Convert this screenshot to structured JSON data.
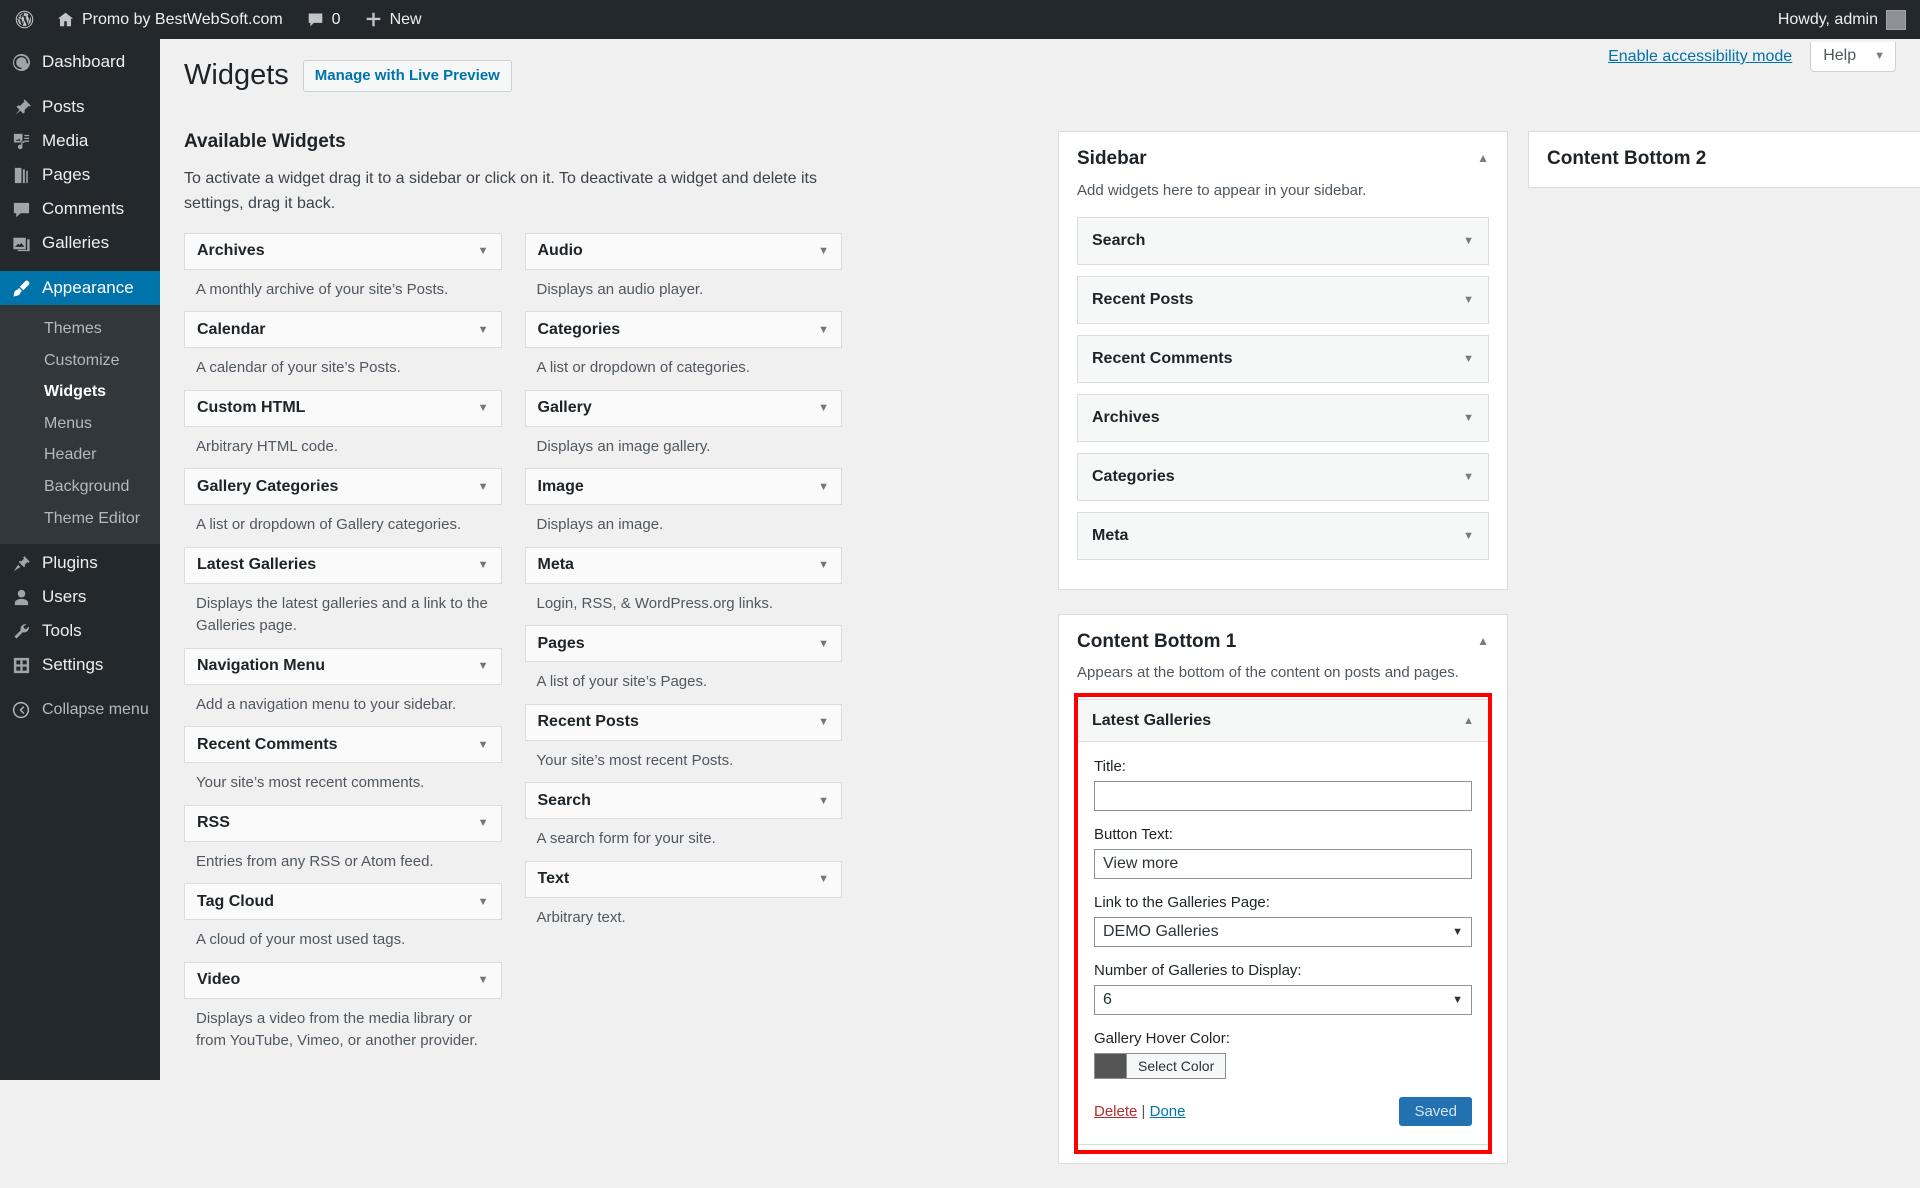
{
  "adminbar": {
    "wp_logo": "wordpress-logo-icon",
    "site_name": "Promo by BestWebSoft.com",
    "comments_count": "0",
    "new_label": "New",
    "howdy": "Howdy, admin"
  },
  "sidebar": {
    "items": [
      {
        "label": "Dashboard",
        "icon": "dashboard-icon",
        "current": false
      },
      {
        "label": "Posts",
        "icon": "pin-icon",
        "current": false
      },
      {
        "label": "Media",
        "icon": "media-icon",
        "current": false
      },
      {
        "label": "Pages",
        "icon": "pages-icon",
        "current": false
      },
      {
        "label": "Comments",
        "icon": "comments-icon",
        "current": false
      },
      {
        "label": "Galleries",
        "icon": "galleries-icon",
        "current": false
      },
      {
        "label": "Appearance",
        "icon": "appearance-brush-icon",
        "current": true
      },
      {
        "label": "Plugins",
        "icon": "plugins-plug-icon",
        "current": false
      },
      {
        "label": "Users",
        "icon": "users-icon",
        "current": false
      },
      {
        "label": "Tools",
        "icon": "tools-wrench-icon",
        "current": false
      },
      {
        "label": "Settings",
        "icon": "settings-gear-icon",
        "current": false
      }
    ],
    "appearance_submenu": [
      {
        "label": "Themes",
        "current": false
      },
      {
        "label": "Customize",
        "current": false
      },
      {
        "label": "Widgets",
        "current": true
      },
      {
        "label": "Menus",
        "current": false
      },
      {
        "label": "Header",
        "current": false
      },
      {
        "label": "Background",
        "current": false
      },
      {
        "label": "Theme Editor",
        "current": false
      }
    ],
    "collapse_label": "Collapse menu",
    "collapse_icon": "collapse-arrow-icon"
  },
  "screen_meta": {
    "accessibility_link": "Enable accessibility mode",
    "help_label": "Help",
    "help_caret": "chevron-down-icon"
  },
  "page": {
    "title": "Widgets",
    "live_preview_button": "Manage with Live Preview",
    "available_heading": "Available Widgets",
    "available_description": "To activate a widget drag it to a sidebar or click on it. To deactivate a widget and delete its settings, drag it back."
  },
  "available_widgets": {
    "left_column": [
      {
        "name": "Archives",
        "description": "A monthly archive of your site’s Posts."
      },
      {
        "name": "Calendar",
        "description": "A calendar of your site’s Posts."
      },
      {
        "name": "Custom HTML",
        "description": "Arbitrary HTML code."
      },
      {
        "name": "Gallery Categories",
        "description": "A list or dropdown of Gallery categories."
      },
      {
        "name": "Latest Galleries",
        "description": "Displays the latest galleries and a link to the Galleries page."
      },
      {
        "name": "Navigation Menu",
        "description": "Add a navigation menu to your sidebar."
      },
      {
        "name": "Recent Comments",
        "description": "Your site’s most recent comments."
      },
      {
        "name": "RSS",
        "description": "Entries from any RSS or Atom feed."
      },
      {
        "name": "Tag Cloud",
        "description": "A cloud of your most used tags."
      },
      {
        "name": "Video",
        "description": "Displays a video from the media library or from YouTube, Vimeo, or another provider."
      }
    ],
    "right_column": [
      {
        "name": "Audio",
        "description": "Displays an audio player."
      },
      {
        "name": "Categories",
        "description": "A list or dropdown of categories."
      },
      {
        "name": "Gallery",
        "description": "Displays an image gallery."
      },
      {
        "name": "Image",
        "description": "Displays an image."
      },
      {
        "name": "Meta",
        "description": "Login, RSS, & WordPress.org links."
      },
      {
        "name": "Pages",
        "description": "A list of your site’s Pages."
      },
      {
        "name": "Recent Posts",
        "description": "Your site’s most recent Posts."
      },
      {
        "name": "Search",
        "description": "A search form for your site."
      },
      {
        "name": "Text",
        "description": "Arbitrary text."
      }
    ]
  },
  "sidebar_areas": {
    "sidebar": {
      "title": "Sidebar",
      "description": "Add widgets here to appear in your sidebar.",
      "widgets": [
        "Search",
        "Recent Posts",
        "Recent Comments",
        "Archives",
        "Categories",
        "Meta"
      ]
    },
    "content_bottom_1": {
      "title": "Content Bottom 1",
      "description": "Appears at the bottom of the content on posts and pages."
    },
    "content_bottom_2": {
      "title": "Content Bottom 2"
    }
  },
  "latest_galleries_form": {
    "widget_title": "Latest Galleries",
    "title_label": "Title:",
    "title_value": "",
    "button_text_label": "Button Text:",
    "button_text_value": "View more",
    "link_label": "Link to the Galleries Page:",
    "link_value": "DEMO Galleries",
    "number_label": "Number of Galleries to Display:",
    "number_value": "6",
    "hover_color_label": "Gallery Hover Color:",
    "select_color_button": "Select Color",
    "hover_color_hex": "#555555",
    "delete_label": "Delete",
    "separator": "|",
    "done_label": "Done",
    "save_button": "Saved"
  },
  "colors": {
    "accent": "#0073aa",
    "admin_bg": "#23282d",
    "highlight": "#ff0000"
  }
}
